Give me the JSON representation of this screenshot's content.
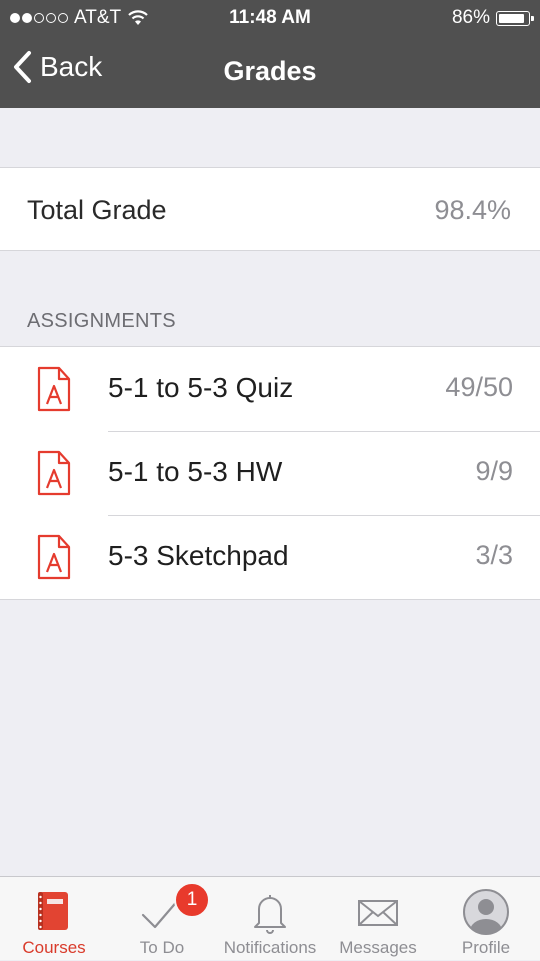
{
  "status_bar": {
    "carrier": "AT&T",
    "time": "11:48 AM",
    "battery": "86%",
    "signal_bars": 2,
    "battery_level": 0.86
  },
  "nav": {
    "back_label": "Back",
    "title": "Grades"
  },
  "total": {
    "label": "Total Grade",
    "value": "98.4%"
  },
  "assignments": {
    "header": "ASSIGNMENTS",
    "items": [
      {
        "name": "5-1 to 5-3 Quiz",
        "score": "49/50",
        "icon": "assignment-icon"
      },
      {
        "name": "5-1 to 5-3 HW",
        "score": "9/9",
        "icon": "assignment-icon"
      },
      {
        "name": "5-3 Sketchpad",
        "score": "3/3",
        "icon": "assignment-icon"
      }
    ]
  },
  "tabs": [
    {
      "label": "Courses",
      "icon": "courses-icon",
      "active": true
    },
    {
      "label": "To Do",
      "icon": "todo-check-icon",
      "badge": "1"
    },
    {
      "label": "Notifications",
      "icon": "bell-icon"
    },
    {
      "label": "Messages",
      "icon": "envelope-icon"
    },
    {
      "label": "Profile",
      "icon": "profile-icon"
    }
  ],
  "colors": {
    "nav_bar": "#505050",
    "accent": "#d93b2b",
    "badge": "#e83a2c",
    "secondary_text": "#8e8e93",
    "background": "#eeeef3"
  }
}
